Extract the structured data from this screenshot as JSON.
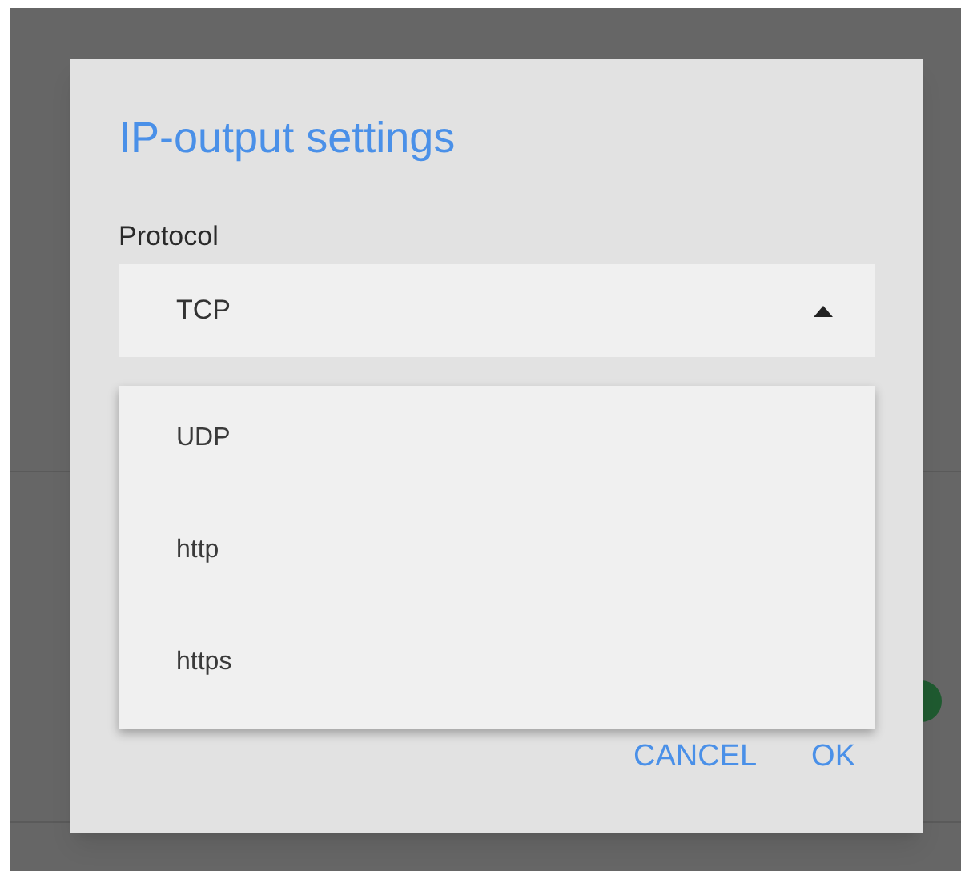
{
  "background": {
    "toggle": {
      "on": true
    }
  },
  "dialog": {
    "title": "IP-output settings",
    "protocol": {
      "label": "Protocol",
      "value": "TCP",
      "expanded": true,
      "options": [
        {
          "label": "UDP",
          "selected": false
        },
        {
          "label": "http",
          "selected": false
        },
        {
          "label": "https",
          "selected": false
        }
      ]
    },
    "buttons": [
      "CANCEL",
      "OK"
    ]
  }
}
